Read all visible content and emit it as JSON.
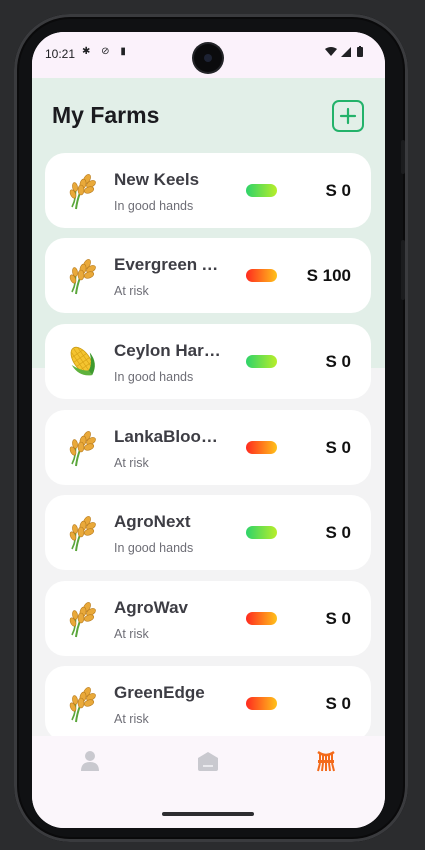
{
  "status_bar": {
    "time": "10:21",
    "left_icons": "✱ ⊘ ▮",
    "right_icons": "▾◢▮"
  },
  "header": {
    "title": "My Farms",
    "add_icon": "plus-square-icon"
  },
  "farms": [
    {
      "name": "New Keels",
      "status": "In good hands",
      "health": "good",
      "amount": "S 0",
      "icon": "wheat-icon"
    },
    {
      "name": "Evergreen A...",
      "status": "At risk",
      "health": "risk",
      "amount": "S 100",
      "icon": "wheat-icon"
    },
    {
      "name": "Ceylon Harv...",
      "status": "In good hands",
      "health": "good",
      "amount": "S 0",
      "icon": "corn-icon"
    },
    {
      "name": "LankaBloom...",
      "status": "At risk",
      "health": "risk",
      "amount": "S 0",
      "icon": "wheat-icon"
    },
    {
      "name": "AgroNext",
      "status": "In good hands",
      "health": "good",
      "amount": "S 0",
      "icon": "wheat-icon"
    },
    {
      "name": "AgroWav",
      "status": "At risk",
      "health": "risk",
      "amount": "S 0",
      "icon": "wheat-icon"
    },
    {
      "name": "GreenEdge",
      "status": "At risk",
      "health": "risk",
      "amount": "S 0",
      "icon": "wheat-icon"
    }
  ],
  "bottom_nav": [
    {
      "icon": "person-icon",
      "active": false
    },
    {
      "icon": "barn-icon",
      "active": false
    },
    {
      "icon": "wheat-bundle-icon",
      "active": true
    }
  ],
  "colors": {
    "accent": "#23b26a",
    "nav_active": "#f36a1b",
    "nav_inactive": "#c9c9cf",
    "good_gradient": [
      "#2ed36a",
      "#b8ee2a"
    ],
    "risk_gradient": [
      "#ff2a1f",
      "#ffc21a"
    ]
  }
}
